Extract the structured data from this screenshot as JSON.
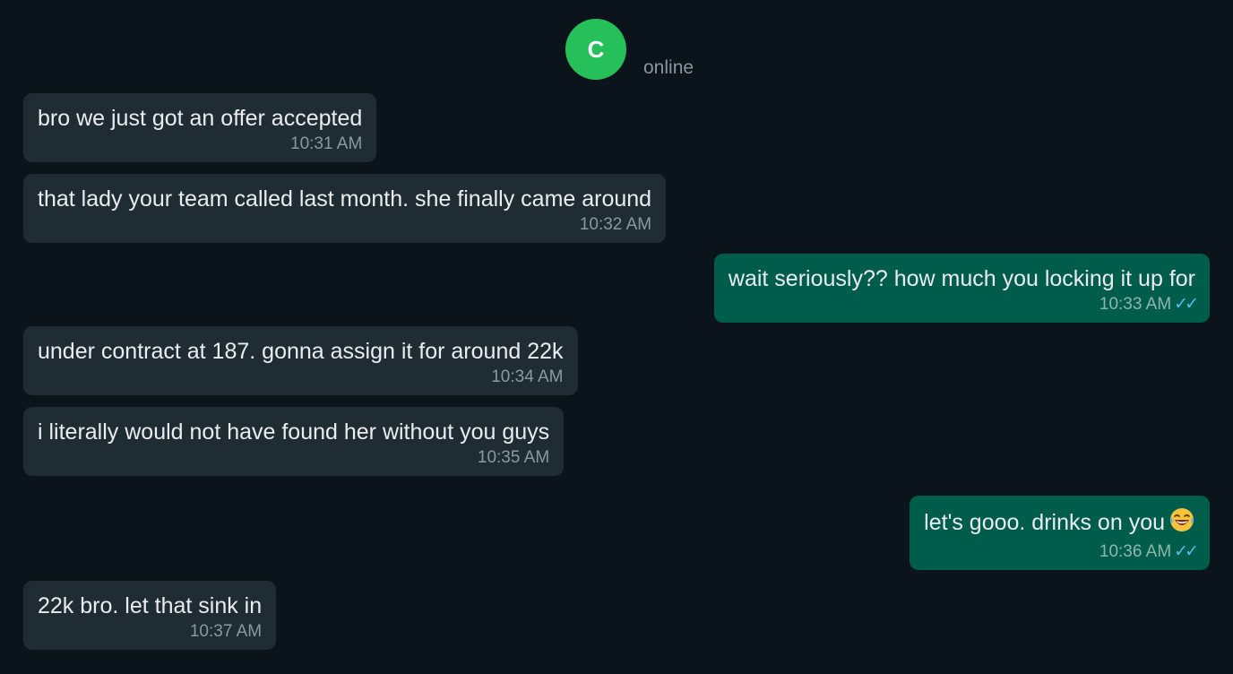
{
  "contact": {
    "avatar_letter": "C",
    "status": "online"
  },
  "colors": {
    "background": "#0b141a",
    "incoming_bubble": "#202c33",
    "outgoing_bubble": "#005c4b",
    "avatar": "#25c05a",
    "read_ticks": "#53bdeb"
  },
  "messages": [
    {
      "direction": "incoming",
      "text": "bro we just got an offer accepted",
      "time": "10:31 AM"
    },
    {
      "direction": "incoming",
      "text": "that lady your team called last month. she finally came around",
      "time": "10:32 AM"
    },
    {
      "direction": "outgoing",
      "text": "wait seriously?? how much you locking it up for",
      "time": "10:33 AM",
      "ticks": "✓✓"
    },
    {
      "direction": "incoming",
      "text": "under contract at 187. gonna assign it for around 22k",
      "time": "10:34 AM"
    },
    {
      "direction": "incoming",
      "text": "i literally would not have found her without you guys",
      "time": "10:35 AM"
    },
    {
      "direction": "outgoing",
      "text": "let's gooo. drinks on you",
      "emoji": "face-with-tears-of-joy-icon",
      "time": "10:36 AM",
      "ticks": "✓✓"
    },
    {
      "direction": "incoming",
      "text": "22k bro. let that sink in",
      "time": "10:37 AM"
    }
  ]
}
